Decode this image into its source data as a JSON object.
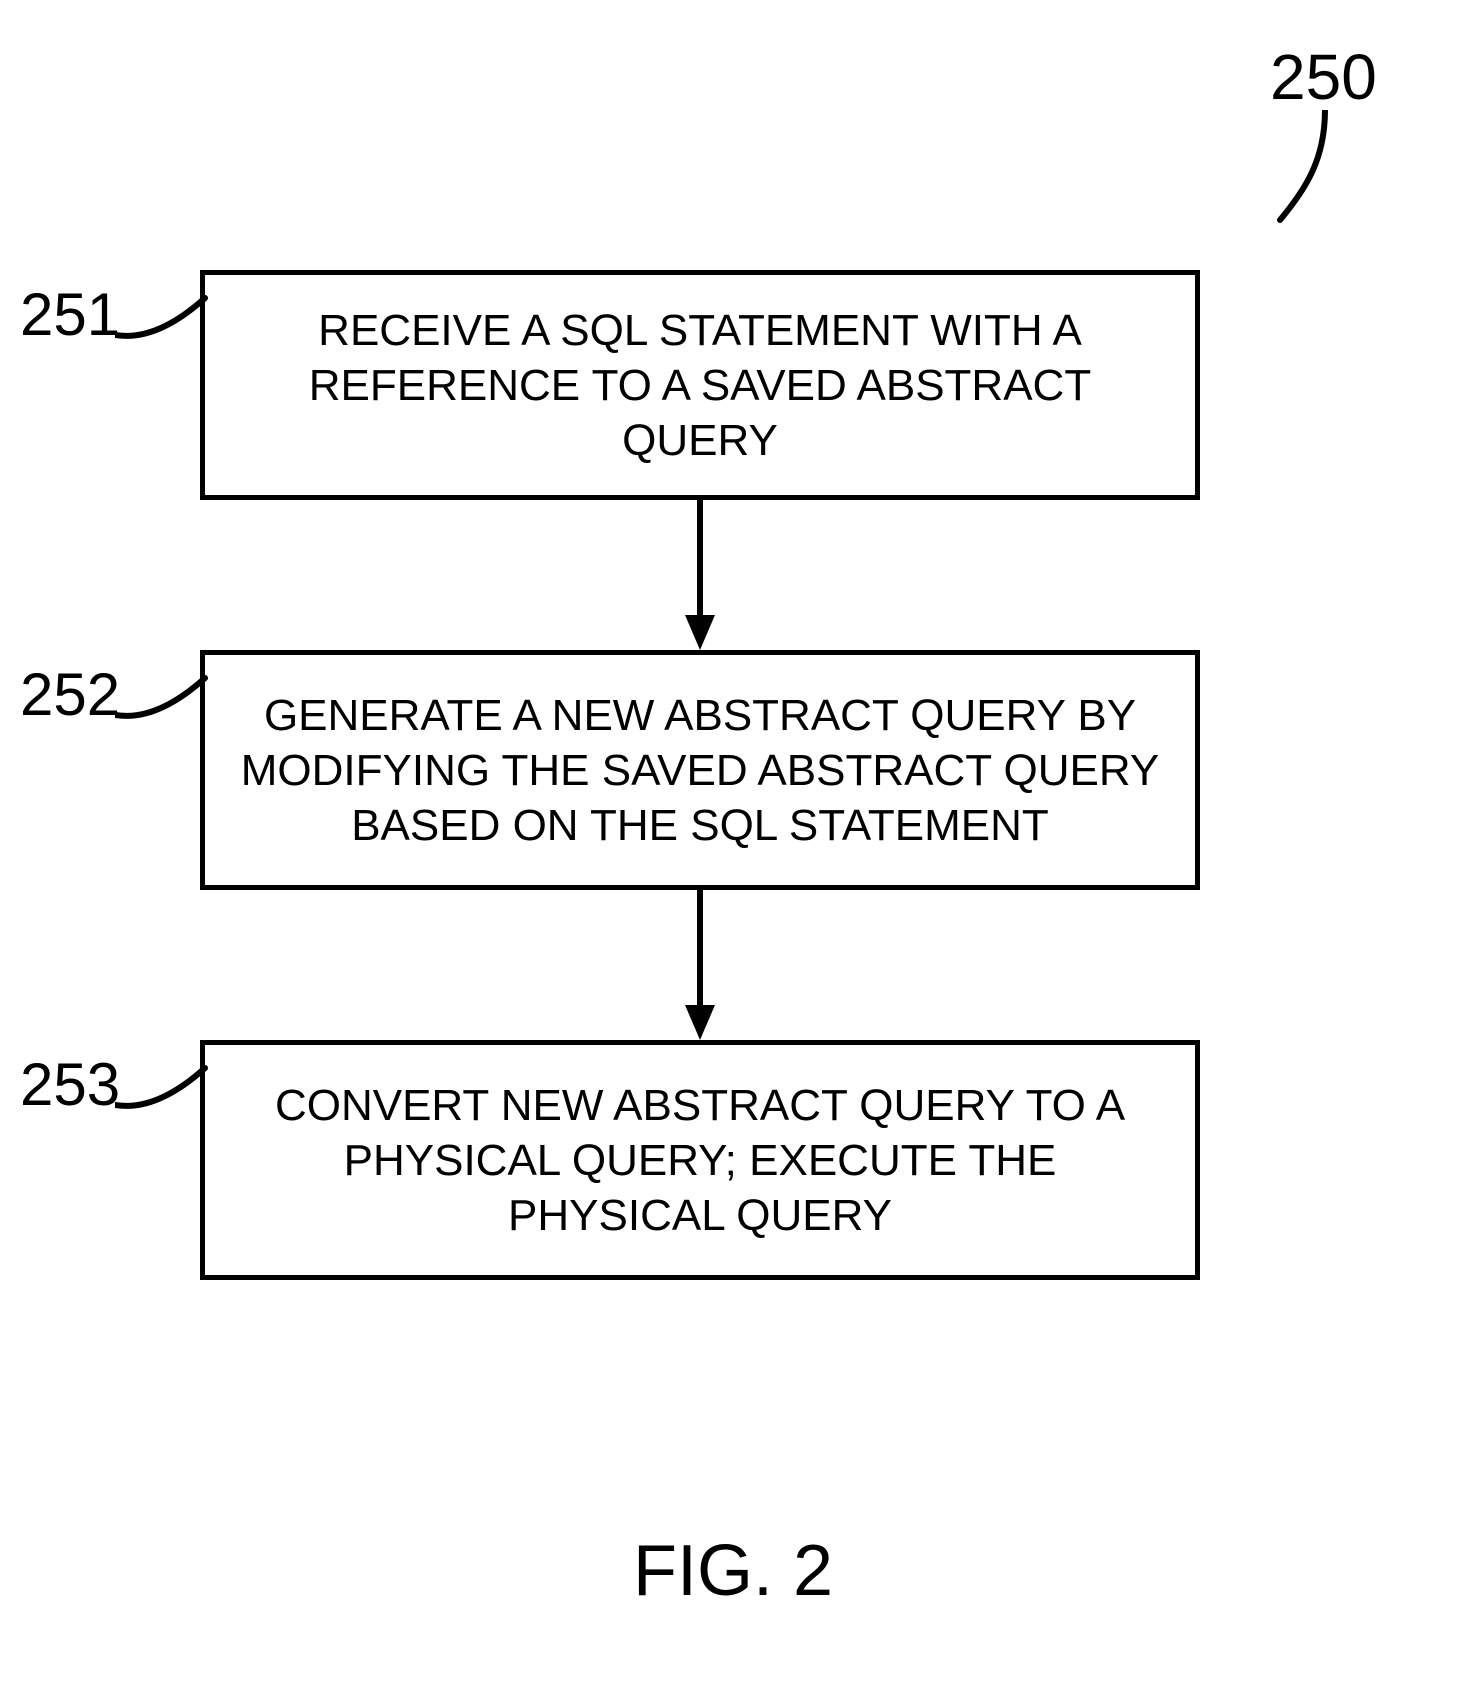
{
  "figure": {
    "number_label": "250",
    "caption": "FIG. 2"
  },
  "steps": [
    {
      "ref": "251",
      "text": "RECEIVE A SQL STATEMENT WITH A REFERENCE TO A SAVED ABSTRACT QUERY"
    },
    {
      "ref": "252",
      "text": "GENERATE A NEW ABSTRACT QUERY BY MODIFYING THE SAVED ABSTRACT QUERY BASED ON THE SQL STATEMENT"
    },
    {
      "ref": "253",
      "text": "CONVERT NEW ABSTRACT QUERY TO A PHYSICAL QUERY; EXECUTE THE PHYSICAL QUERY"
    }
  ]
}
